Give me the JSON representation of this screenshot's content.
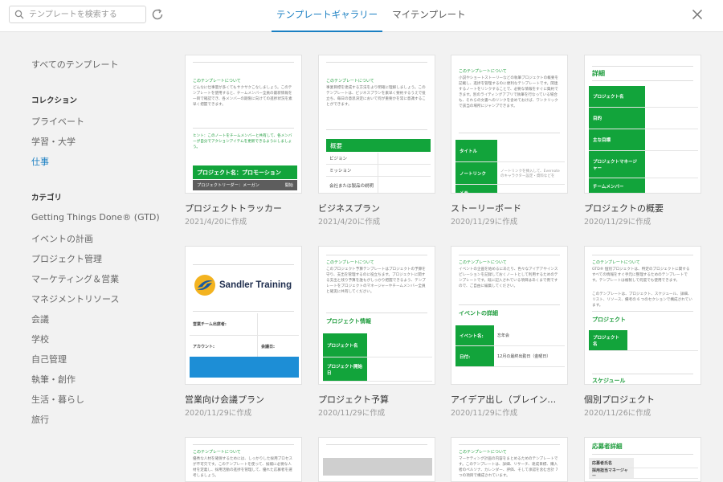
{
  "header": {
    "search_placeholder": "テンプレートを検索する",
    "tabs": [
      {
        "label": "テンプレートギャラリー",
        "active": true
      },
      {
        "label": "マイテンプレート",
        "active": false
      }
    ]
  },
  "sidebar": {
    "all_templates": "すべてのテンプレート",
    "collections_heading": "コレクション",
    "collections": [
      "プライベート",
      "学習・大学",
      "仕事"
    ],
    "active_collection": "仕事",
    "categories_heading": "カテゴリ",
    "categories": [
      "Getting Things Done® (GTD)",
      "イベントの計画",
      "プロジェクト管理",
      "マーケティング＆営業",
      "マネジメントリソース",
      "会議",
      "学校",
      "自己管理",
      "執筆・創作",
      "生活・暮らし",
      "旅行"
    ]
  },
  "cards": [
    {
      "title": "プロジェクトトラッカー",
      "date": "2021/4/20に作成"
    },
    {
      "title": "ビジネスプラン",
      "date": "2021/4/20に作成"
    },
    {
      "title": "ストーリーボード",
      "date": "2020/11/29に作成"
    },
    {
      "title": "プロジェクトの概要",
      "date": "2020/11/29に作成"
    },
    {
      "title": "営業向け会議プラン",
      "date": "2020/11/29に作成"
    },
    {
      "title": "プロジェクト予算",
      "date": "2020/11/29に作成"
    },
    {
      "title": "アイデア出し（ブレインストーミング）",
      "date": "2020/11/29に作成"
    },
    {
      "title": "個別プロジェクト",
      "date": "2020/11/26に作成"
    }
  ],
  "thumbs": {
    "about_label": "このテンプレートについて",
    "t1": {
      "text": "どんなに仕事量が多くてもサクサクこなしましょう。このテンプレートを使用すると、チームメンバー全員の最新情報を一目で確認でき、各メンバーの期限に向けての進捗状況を素早く把握できます。",
      "hint": "ヒント：このノートをチームメンバーと共有して、各メンバーが自分でアクションアイテムを更新できるようにしましょう。",
      "banner": "プロジェクト名：プロモーション",
      "leader": "プロジェクトリーダー：メーガン",
      "start": "開始"
    },
    "t2": {
      "text": "事業目標を達成する方法をより明確に理解しましょう。このテンプレートは、ビジネスプランを素早く要約するうえで役立ち、毎日の意思決定において何が重要かを常に意識することができます。",
      "header": "概要",
      "rows": [
        "ビジョン",
        "ミッション",
        "会社または製品の説明"
      ]
    },
    "t3": {
      "text": "小説やショートストーリーなどの執筆プロジェクトの概要を記載し、進捗を管理するのに便利なテンプレートです。関連するノートをリンクすることで、必要な情報をすぐに集約できます。別のライティングアプリで執筆を行なっている場合も、それらの文書へのリンクを含めておけば、ワンクリックで該当の場所にジャンプできます。",
      "rows": [
        "タイトル",
        "ノートリンク",
        "メモ"
      ],
      "link_text": "ノートリンクを挿入して、Evernote のキャラクター設定・資料などを"
    },
    "t4": {
      "header": "詳細",
      "rows": [
        "プロジェクト名",
        "目的",
        "主な目標",
        "プロジェクトマネージャー",
        "チームメンバー"
      ]
    },
    "t5": {
      "logo_text": "Sandler Training",
      "rows": [
        "営業チーム出席者:",
        "アカウント:"
      ],
      "meeting_date": "会議日:"
    },
    "t6": {
      "text": "このプロジェクト予算テンプレートはプロジェクトの予算を守り、支出を管理するのに役立ちます。プロジェクトに関する支出と残り予算を誰もがしっかり把握できるよう、テンプレートをプロジェクトのマネージャーやチームメンバー全員と確実に共有してください。",
      "header": "プロジェクト情報",
      "rows": [
        "プロジェクト名",
        "プロジェクト開始日"
      ]
    },
    "t7": {
      "text": "イベントの企画を始めるにあたり、色々なアイデアやインスピレーションを記録しておくノートとして利用するためのテンプレートです。既に記入されている項目はあくまで例ですので、ご自由に編集してください。",
      "header": "イベントの詳細",
      "rows": [
        {
          "label": "イベント名:",
          "value": "忘年会"
        },
        {
          "label": "日付:",
          "value": "12月の最終出勤日（金曜日）"
        }
      ]
    },
    "t8": {
      "text": "GTD® 個別プロジェクトは、特定のプロジェクトに関するすべての情報をすぐ手元に整理するためのテンプレートです。テンプレートは複製して何度でも使用できます。",
      "text2": "このテンプレートは、プロジェクト、スケジュール、詳細、リスト、リソース、備考の 6 つのセクションで構成されています。",
      "header": "プロジェクト",
      "row": "プロジェクト名",
      "header2": "スケジュール"
    },
    "t9": {
      "text": "優秀な人材を確保するためには、しっかりした採用プロセスが不可欠です。このテンプレートを使って、候補に必要な人材を定義し、採用活動の進捗を管理して、優れた応募者を選考しましょう。"
    },
    "t11": {
      "text": "マーケティング計画の内容をまとめるためのテンプレートです。このテンプレートは、詳細、リサーチ、達成目標、購入者のペルソナ、カレンダー、評価、そして承認を含む合計 7 つの項目で構成されています。"
    },
    "t12": {
      "header": "応募者詳細",
      "rows": [
        "応募者氏名",
        "採用担当マネージャー"
      ]
    }
  },
  "colors": {
    "accent": "#1a7fc2",
    "template_green": "#12a43b"
  }
}
